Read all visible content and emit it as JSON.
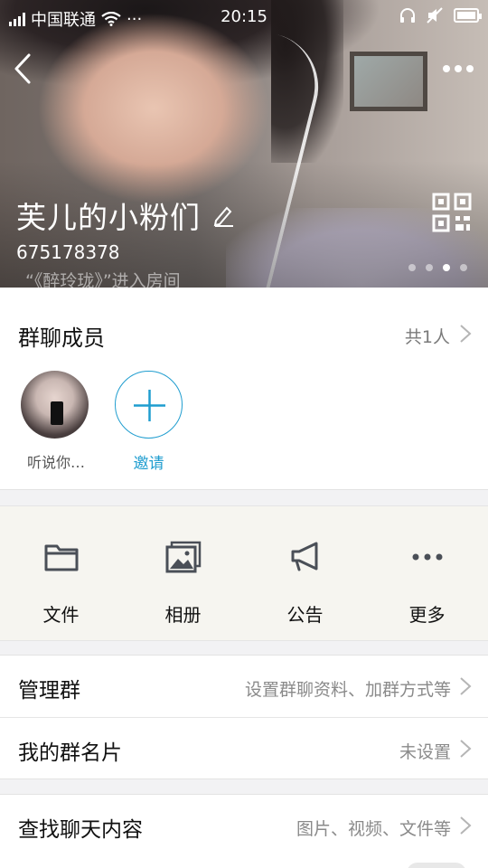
{
  "status_bar": {
    "carrier": "中国联通",
    "extra": "···",
    "time": "20:15"
  },
  "header": {
    "group_name": "芙儿的小粉们",
    "group_id": "675178378",
    "ticker_text": "“《醉玲珑》”进入房间",
    "carousel_pages": 4,
    "carousel_active_index": 2
  },
  "members": {
    "title": "群聊成员",
    "count_label": "共1人",
    "list": [
      {
        "name": "听说你…"
      }
    ],
    "invite_label": "邀请"
  },
  "features": [
    {
      "label": "文件",
      "icon": "folder-icon"
    },
    {
      "label": "相册",
      "icon": "photo-album-icon"
    },
    {
      "label": "公告",
      "icon": "megaphone-icon"
    },
    {
      "label": "更多",
      "icon": "more-dots-icon"
    }
  ],
  "settings_group_1": {
    "manage": {
      "title": "管理群",
      "value": "设置群聊资料、加群方式等"
    },
    "card": {
      "title": "我的群名片",
      "value": "未设置"
    }
  },
  "settings_group_2": {
    "search": {
      "title": "查找聊天内容",
      "value": "图片、视频、文件等"
    }
  },
  "colors": {
    "accent": "#1f9dcf",
    "feature_bg": "#f6f5f0",
    "icon_gray": "#4a4f57"
  }
}
